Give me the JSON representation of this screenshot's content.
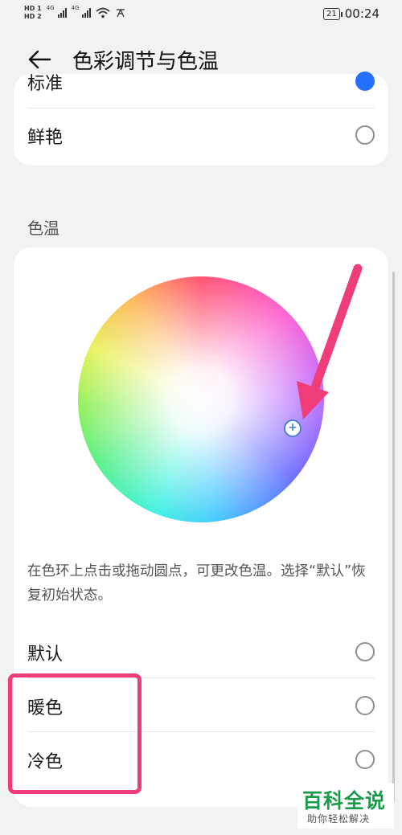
{
  "status_bar": {
    "sim1": "HD 1",
    "sim2": "HD 2",
    "net1": "4G",
    "net2": "4G",
    "battery": "21",
    "time": "00:24"
  },
  "header": {
    "title": "色彩调节与色温"
  },
  "color_mode": {
    "options": [
      {
        "label": "标准",
        "checked": true
      },
      {
        "label": "鲜艳",
        "checked": false
      }
    ]
  },
  "color_temp": {
    "section_title": "色温",
    "description": "在色环上点击或拖动圆点，可更改色温。选择“默认”恢复初始状态。",
    "knob_symbol": "+",
    "options": [
      {
        "label": "默认",
        "checked": false
      },
      {
        "label": "暖色",
        "checked": false
      },
      {
        "label": "冷色",
        "checked": false
      }
    ]
  },
  "watermark": {
    "title": "百科全说",
    "subtitle": "助你轻松解决"
  },
  "colors": {
    "accent": "#256fff",
    "annotation": "#ee3d79",
    "watermark_green": "#1b9a4a"
  },
  "icons": [
    "back-arrow-icon",
    "wifi-icon",
    "signal-icon",
    "battery-icon",
    "annotation-arrow-icon"
  ]
}
